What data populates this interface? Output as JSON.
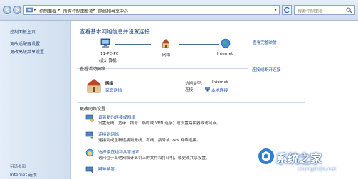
{
  "address_bar": {
    "crumbs": [
      "控制面板",
      "所有控制面板项",
      "网络和共享中心"
    ]
  },
  "search": {
    "placeholder": "搜索控制面板"
  },
  "sidebar": {
    "items": [
      {
        "label": "控制面板主页"
      },
      {
        "label": "更改适配器设置"
      },
      {
        "label": "更改高级共享设置"
      }
    ],
    "see_also_title": "另请参阅",
    "see_also_items": [
      {
        "label": "Internet 选项"
      }
    ]
  },
  "main": {
    "title": "查看基本网络信息并设置连接",
    "full_map_link": "查看完整映射",
    "map": {
      "computer": "11-PC-PC",
      "computer_sub": "(此计算机)",
      "network": "网络",
      "internet": "Internet"
    },
    "active_networks": {
      "header": "查看活动网络",
      "connect_link": "连接或断开连接",
      "network_name": "网络",
      "network_type": "家庭网络",
      "access_type_label": "访问类型:",
      "access_type_value": "Internet",
      "connections_label": "连接:",
      "connections_value": "本地连接"
    },
    "change_settings": {
      "header": "更改网络设置",
      "items": [
        {
          "title": "设置新的连接或网络",
          "desc": "设置无线、宽带、拨号、临时或 VPN 连接；或设置路由器或访问点。"
        },
        {
          "title": "连接到网络",
          "desc": "连接到或重新连接到无线、有线、拨号或 VPN 网络连接。"
        },
        {
          "title": "选择家庭组和共享选项",
          "desc": "访问位于其他网络计算机上的文件和打印机，或更改共享设置。"
        },
        {
          "title": "疑难解答",
          "desc": ""
        }
      ]
    }
  },
  "watermark": {
    "text": "系统之家",
    "url": "xitongzhijia.net"
  }
}
